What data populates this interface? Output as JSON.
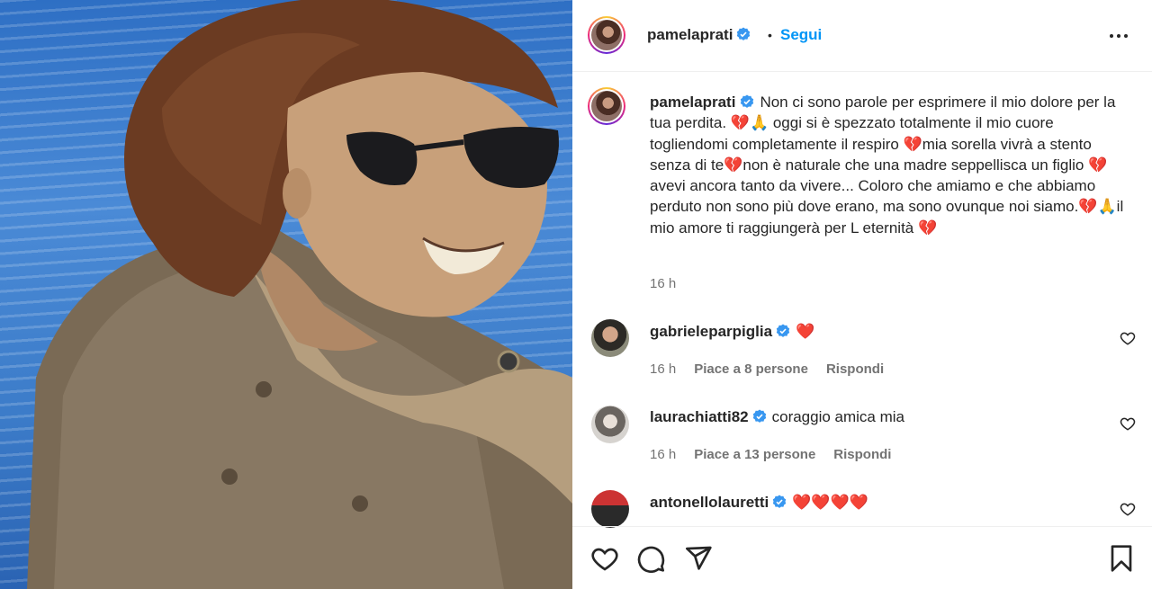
{
  "post": {
    "username": "pamelaprati",
    "follow_label": "Segui",
    "separator": "•",
    "caption": "Non ci sono parole per esprimere il mio dolore per la tua perdita. 💔🙏 oggi si è spezzato totalmente il mio cuore togliendomi completamente il respiro 💔mia sorella vivrà a stento senza di te💔non è naturale che una madre seppellisca un figlio 💔avevi ancora tanto da vivere... Coloro che amiamo e che abbiamo perduto non sono più dove erano, ma sono ovunque noi siamo.💔🙏il mio amore ti raggiungerà per L eternità 💔",
    "time": "16 h"
  },
  "comments": [
    {
      "username": "gabrieleparpiglia",
      "text": "❤️",
      "time": "16 h",
      "likes": "Piace a 8 persone",
      "reply": "Rispondi"
    },
    {
      "username": "laurachiatti82",
      "text": "coraggio amica mia",
      "time": "16 h",
      "likes": "Piace a 13 persone",
      "reply": "Rispondi"
    },
    {
      "username": "antonellolauretti",
      "text": "❤️❤️❤️❤️",
      "time": "",
      "likes": "",
      "reply": ""
    }
  ],
  "icons": {
    "verified": "verified-badge-icon",
    "more": "more-options-icon",
    "like": "heart-icon",
    "comment": "comment-icon",
    "share": "share-icon",
    "save": "bookmark-icon"
  },
  "colors": {
    "accent": "#0095f6",
    "verified": "#3897f0",
    "muted": "#737373"
  }
}
